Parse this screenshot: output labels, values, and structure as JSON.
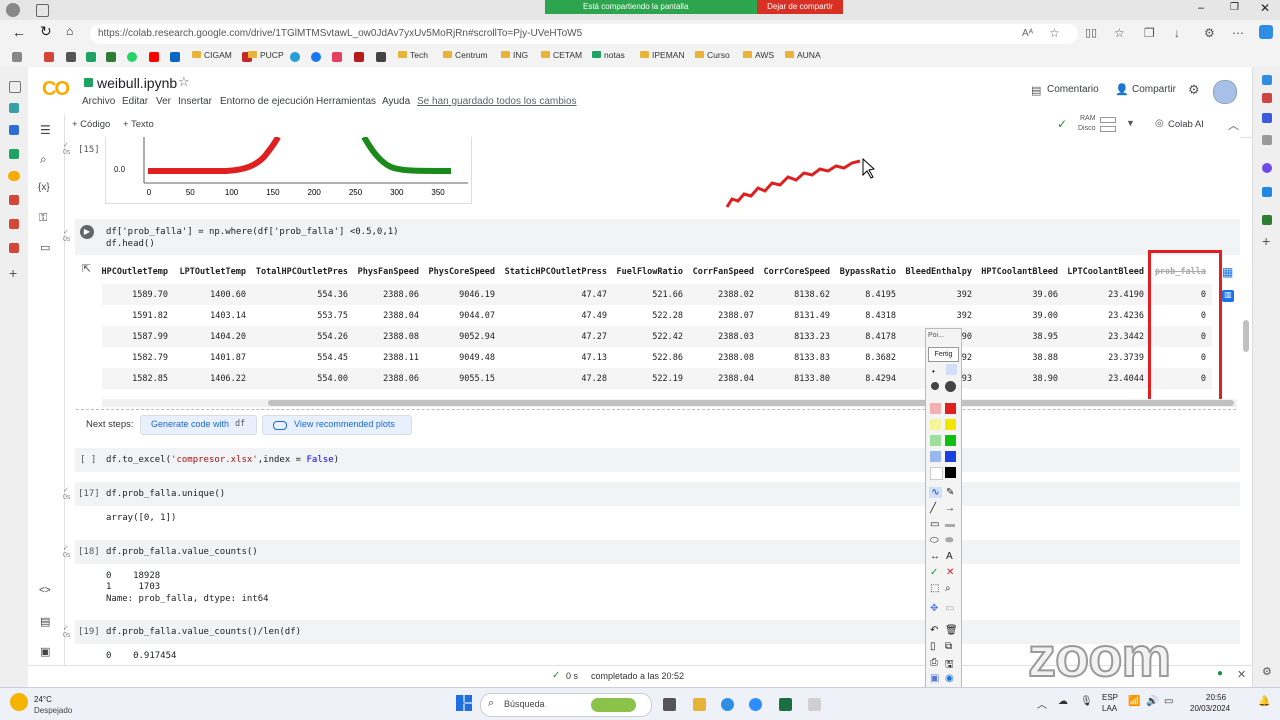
{
  "browser": {
    "share_banner": "Está compartiendo la pantalla",
    "stop_share": "Dejar de compartir",
    "url": "https://colab.research.google.com/drive/1TGlMTMSvtawL_ow0JdAv7yxUv5MoRjRn#scrollTo=Pjy-UVeHToW5",
    "bookmarks": [
      "CIGAM",
      "PUCP",
      "Tech",
      "Centrum",
      "ING",
      "CETAM",
      "notas",
      "IPEMAN",
      "Curso",
      "AWS",
      "AUNA"
    ]
  },
  "colab": {
    "logo": "CO",
    "notebook_title": "weibull.ipynb",
    "menus": [
      "Archivo",
      "Editar",
      "Ver",
      "Insertar",
      "Entorno de ejecución",
      "Herramientas",
      "Ayuda"
    ],
    "saved_status": "Se han guardado todos los cambios",
    "comment_label": "Comentario",
    "share_label": "Compartir",
    "add_code": "+ Código",
    "add_text": "+ Texto",
    "ram_label": "RAM",
    "disk_label": "Disco",
    "colab_ai": "Colab AI"
  },
  "plot_cell": {
    "prompt": "[15]",
    "ytick": "0.0",
    "xticks": [
      "0",
      "50",
      "100",
      "150",
      "200",
      "250",
      "300",
      "350"
    ]
  },
  "cell_where": {
    "code_line1": "df['prob_falla'] = np.where(df['prob_falla'] <0.5,0,1)",
    "code_line2": "df.head()"
  },
  "table": {
    "columns": [
      "HPCOutletTemp",
      "LPTOutletTemp",
      "TotalHPCOutletPres",
      "PhysFanSpeed",
      "PhysCoreSpeed",
      "StaticHPCOutletPress",
      "FuelFlowRatio",
      "CorrFanSpeed",
      "CorrCoreSpeed",
      "BypassRatio",
      "BleedEnthalpy",
      "HPTCoolantBleed",
      "LPTCoolantBleed",
      "prob_falla"
    ],
    "rows": [
      [
        "1589.70",
        "1400.60",
        "554.36",
        "2388.06",
        "9046.19",
        "47.47",
        "521.66",
        "2388.02",
        "8138.62",
        "8.4195",
        "392",
        "39.06",
        "23.4190",
        "0"
      ],
      [
        "1591.82",
        "1403.14",
        "553.75",
        "2388.04",
        "9044.07",
        "47.49",
        "522.28",
        "2388.07",
        "8131.49",
        "8.4318",
        "392",
        "39.00",
        "23.4236",
        "0"
      ],
      [
        "1587.99",
        "1404.20",
        "554.26",
        "2388.08",
        "9052.94",
        "47.27",
        "522.42",
        "2388.03",
        "8133.23",
        "8.4178",
        "390",
        "38.95",
        "23.3442",
        "0"
      ],
      [
        "1582.79",
        "1401.87",
        "554.45",
        "2388.11",
        "9049.48",
        "47.13",
        "522.86",
        "2388.08",
        "8133.83",
        "8.3682",
        "392",
        "38.88",
        "23.3739",
        "0"
      ],
      [
        "1582.85",
        "1406.22",
        "554.00",
        "2388.06",
        "9055.15",
        "47.28",
        "522.19",
        "2388.04",
        "8133.80",
        "8.4294",
        "393",
        "38.90",
        "23.4044",
        "0"
      ]
    ]
  },
  "next_steps": {
    "label": "Next steps:",
    "generate": "Generate code with",
    "df_tag": "df",
    "recommended": "View recommended plots"
  },
  "cells": {
    "excel_prompt": "[ ]",
    "excel_code_a": "df.to_excel(",
    "excel_code_str": "'compresor.xlsx'",
    "excel_code_b": ",index = ",
    "excel_code_kw": "False",
    "excel_code_c": ")",
    "c17_prompt": "[17]",
    "c17_code": "df.prob_falla.unique()",
    "c17_out": "array([0, 1])",
    "c18_prompt": "[18]",
    "c18_code": "df.prob_falla.value_counts()",
    "c18_out1": "0    18928",
    "c18_out2": "1     1703",
    "c18_out3": "Name: prob_falla, dtype: int64",
    "c19_prompt": "[19]",
    "c19_code": "df.prob_falla.value_counts()/len(df)",
    "c19_out1": "0    0.917454"
  },
  "status_bar": {
    "time": "0 s",
    "completed": "completado a las 20:52"
  },
  "paint": {
    "title": "Poi...",
    "tab": "Fertig"
  },
  "overlay": {
    "zoom_logo": "zoom"
  },
  "taskbar": {
    "temp": "24°C",
    "weather": "Despejado",
    "search": "Búsqueda",
    "lang1": "ESP",
    "lang2": "LAA",
    "time": "20:56",
    "date": "20/03/2024"
  },
  "colors": {
    "accent_red": "#e02020",
    "curve_green": "#1a8a1a",
    "colab_orange": "#f9ab00"
  }
}
